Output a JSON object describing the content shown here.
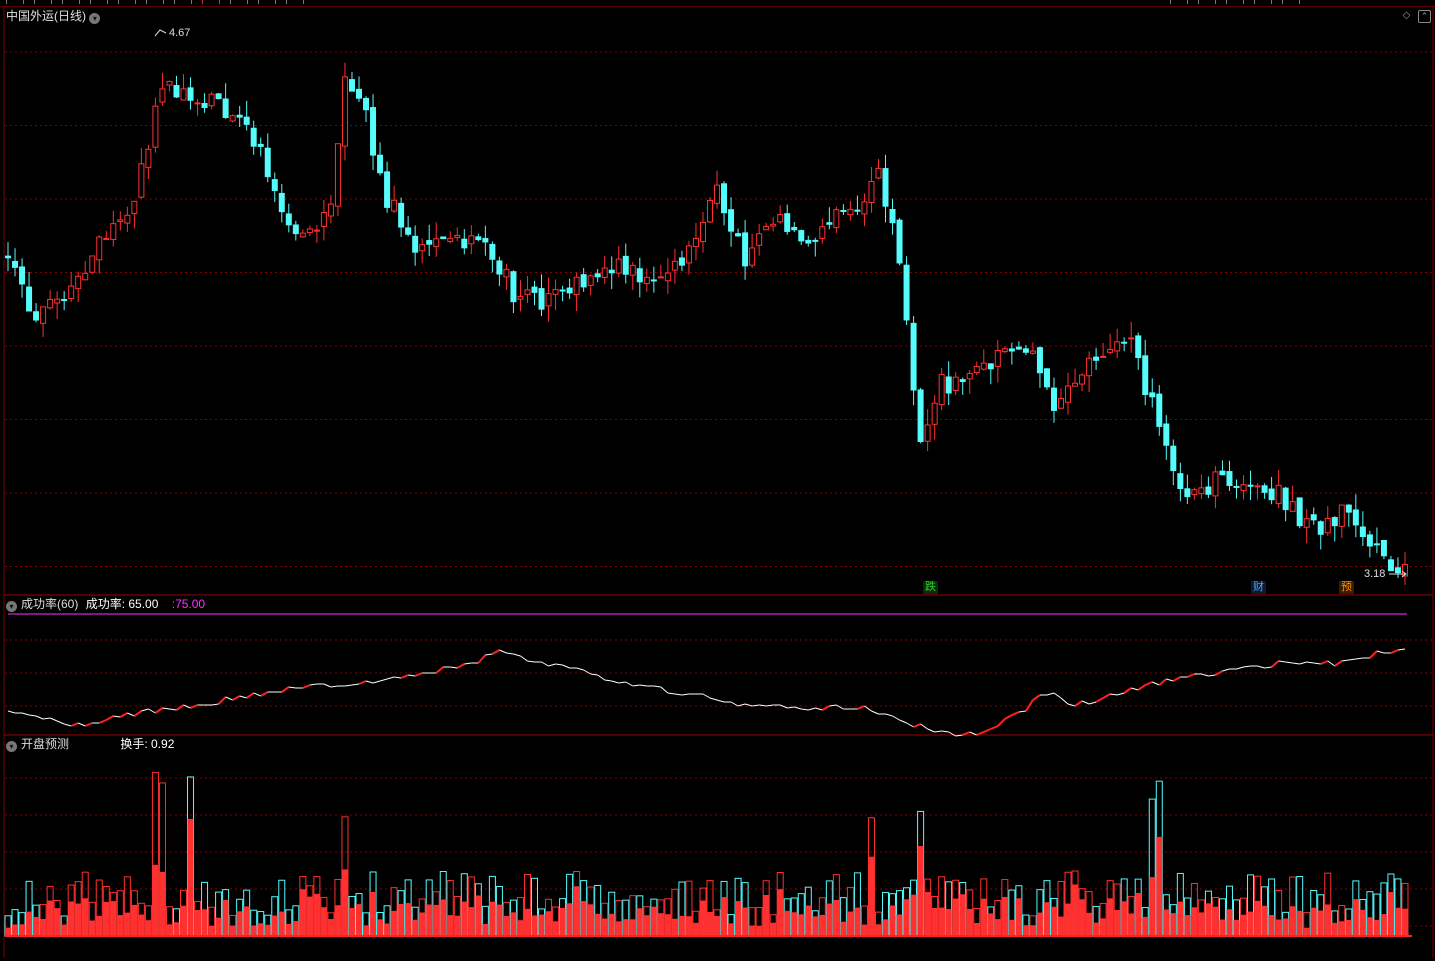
{
  "toolbar": {
    "left_tabs": [
      "",
      "",
      "",
      "",
      "",
      "",
      "",
      "",
      "",
      "",
      ""
    ],
    "right_tabs": [
      "",
      "",
      "",
      "",
      ""
    ],
    "corner": ""
  },
  "main_panel": {
    "stock_name": "中国外运",
    "period": "(日线)",
    "high_label": "4.67",
    "low_label": "3.18",
    "events": [
      {
        "label": "跌",
        "color": "#2bd12b"
      },
      {
        "label": "财",
        "color": "#4aa3ff"
      },
      {
        "label": "预",
        "color": "#ff8c00"
      }
    ]
  },
  "indicator_panel": {
    "name": "成功率(60)",
    "value_label": "成功率: 65.00",
    "ref_label": ":75.00"
  },
  "volume_panel": {
    "name": "开盘预测",
    "value_label": "换手: 0.92"
  },
  "colors": {
    "up": "#ff3030",
    "down": "#54fcfc",
    "grid": "#8b0000",
    "line": "#ffffff",
    "line_rising": "#ff2020",
    "ref_line": "#ff30ff"
  },
  "chart_data": {
    "type": "candlestick",
    "yhigh": 4.67,
    "ylow": 3.18,
    "success_rate_ref": 75.0,
    "success_rate_last": 65.0,
    "turnover_last": 0.92
  }
}
